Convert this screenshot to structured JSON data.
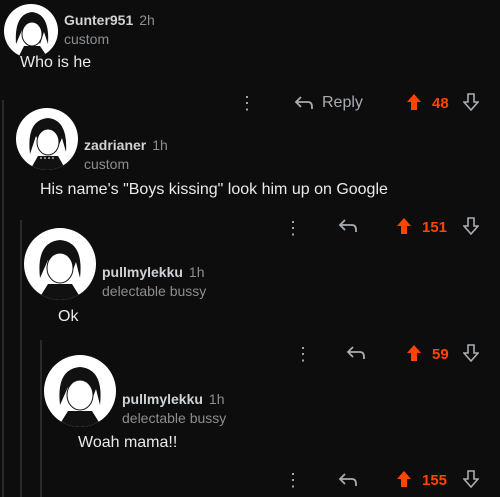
{
  "comments": [
    {
      "username": "Gunter951",
      "age": "2h",
      "flair": "custom",
      "body": "Who is he",
      "reply_label": "Reply",
      "score": "48"
    },
    {
      "username": "zadrianer",
      "age": "1h",
      "flair": "custom",
      "body": "His name's \"Boys kissing\" look him up on Google",
      "score": "151"
    },
    {
      "username": "pullmylekku",
      "age": "1h",
      "flair": "delectable bussy",
      "body": "Ok",
      "score": "59"
    },
    {
      "username": "pullmylekku",
      "age": "1h",
      "flair": "delectable bussy",
      "body": "Woah mama!!",
      "score": "155"
    }
  ],
  "colors": {
    "upvote": "#ff4500",
    "background": "#0d0d0d"
  }
}
